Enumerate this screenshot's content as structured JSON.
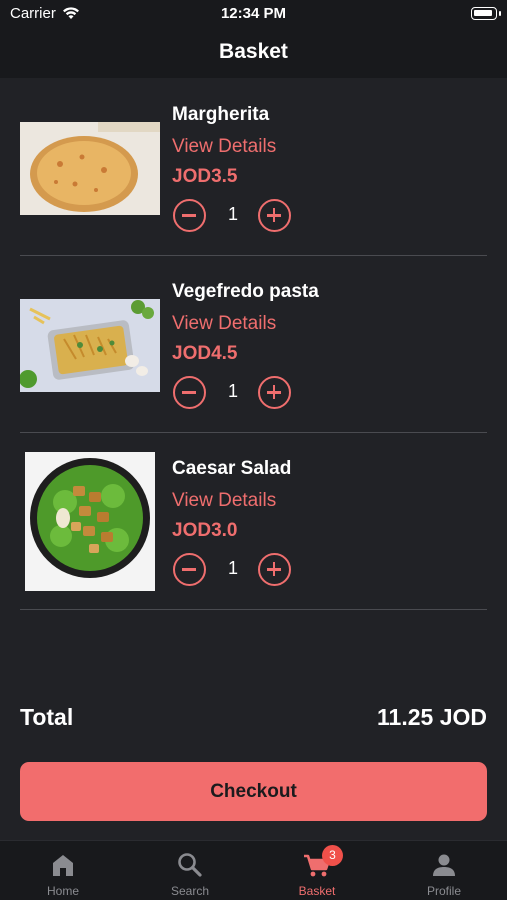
{
  "status_bar": {
    "carrier": "Carrier",
    "time": "12:34 PM"
  },
  "nav": {
    "title": "Basket"
  },
  "items": [
    {
      "name": "Margherita",
      "details_label": "View Details",
      "price": "JOD3.5",
      "quantity": "1",
      "image_icon": "pizza-image"
    },
    {
      "name": "Vegefredo pasta",
      "details_label": "View Details",
      "price": "JOD4.5",
      "quantity": "1",
      "image_icon": "pasta-image"
    },
    {
      "name": "Caesar Salad",
      "details_label": "View Details",
      "price": "JOD3.0",
      "quantity": "1",
      "image_icon": "salad-image"
    }
  ],
  "summary": {
    "total_label": "Total",
    "total_value": "11.25 JOD"
  },
  "checkout": {
    "label": "Checkout"
  },
  "tabs": [
    {
      "label": "Home",
      "icon": "home-icon"
    },
    {
      "label": "Search",
      "icon": "search-icon"
    },
    {
      "label": "Basket",
      "icon": "cart-icon",
      "badge": "3",
      "active": true
    },
    {
      "label": "Profile",
      "icon": "person-icon"
    }
  ],
  "colors": {
    "accent": "#ef6e6e",
    "background": "#212226",
    "bar": "#18191c",
    "badge": "#f0504a"
  }
}
